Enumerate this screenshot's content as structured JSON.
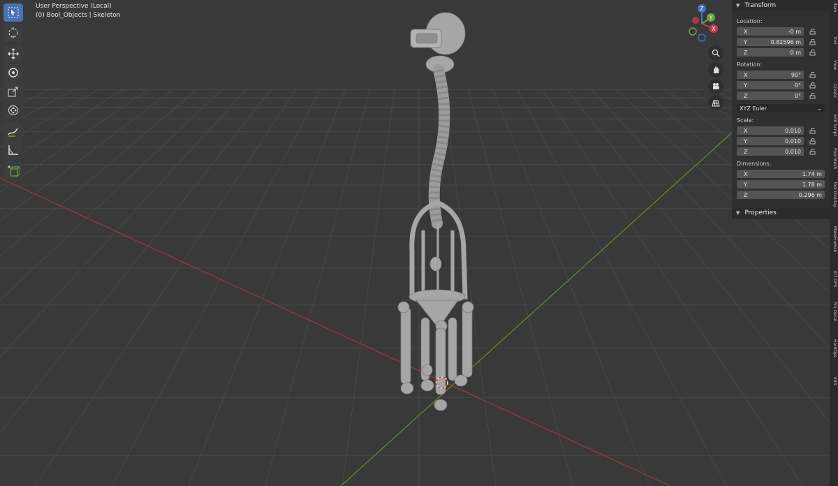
{
  "viewport": {
    "line1": "User Perspective (Local)",
    "line2": "(0) Bool_Objects | Skeleton"
  },
  "toolbar": [
    {
      "name": "select-box-icon",
      "active": true
    },
    {
      "name": "cursor-icon"
    },
    {
      "name": "move-icon"
    },
    {
      "name": "rotate-icon"
    },
    {
      "name": "scale-icon"
    },
    {
      "name": "transform-icon"
    },
    {
      "name": "annotate-icon"
    },
    {
      "name": "measure-icon"
    },
    {
      "name": "add-cube-icon"
    }
  ],
  "gizmo": {
    "z": "Z",
    "y": "Y",
    "x": "X"
  },
  "nav_buttons": [
    "zoom-icon",
    "pan-hand-icon",
    "camera-icon",
    "grid-icon"
  ],
  "npanel": {
    "header": "Transform",
    "location_label": "Location:",
    "location": [
      {
        "axis": "X",
        "value": "-0 m"
      },
      {
        "axis": "Y",
        "value": "0.82596 m"
      },
      {
        "axis": "Z",
        "value": "0 m"
      }
    ],
    "rotation_label": "Rotation:",
    "rotation": [
      {
        "axis": "X",
        "value": "90°"
      },
      {
        "axis": "Y",
        "value": "0°"
      },
      {
        "axis": "Z",
        "value": "0°"
      }
    ],
    "rotation_mode": "XYZ Euler",
    "scale_label": "Scale:",
    "scale": [
      {
        "axis": "X",
        "value": "0.010"
      },
      {
        "axis": "Y",
        "value": "0.010"
      },
      {
        "axis": "Z",
        "value": "0.010"
      }
    ],
    "dimensions_label": "Dimensions:",
    "dimensions": [
      {
        "axis": "X",
        "value": "1.74 m"
      },
      {
        "axis": "Y",
        "value": "1.78 m"
      },
      {
        "axis": "Z",
        "value": "0.296 m"
      }
    ],
    "properties": "Properties"
  },
  "side_tabs": [
    "Item",
    "Tool",
    "View",
    "Create",
    "Edit Script",
    "Pool Mesh",
    "Tool Overlay",
    "MakeHuman",
    "KIT OPS",
    "Pro Decal",
    "HardOps",
    "Edit"
  ],
  "colors": {
    "background": "#393939",
    "grid": "#474747",
    "x_axis": "#9a3a3d",
    "y_axis": "#5e8f2f",
    "accent": "#4772b3",
    "model": "#a6a6a6"
  }
}
